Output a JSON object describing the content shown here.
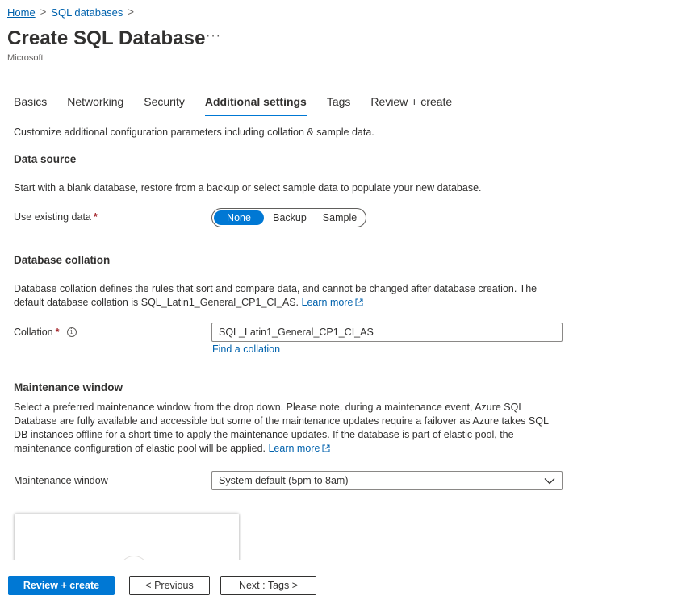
{
  "breadcrumb": {
    "home": "Home",
    "sql_databases": "SQL databases",
    "separator": ">"
  },
  "header": {
    "title": "Create SQL Database",
    "more": "···",
    "publisher": "Microsoft"
  },
  "tabs": [
    {
      "label": "Basics",
      "active": false
    },
    {
      "label": "Networking",
      "active": false
    },
    {
      "label": "Security",
      "active": false
    },
    {
      "label": "Additional settings",
      "active": true
    },
    {
      "label": "Tags",
      "active": false
    },
    {
      "label": "Review + create",
      "active": false
    }
  ],
  "intro": "Customize additional configuration parameters including collation & sample data.",
  "data_source": {
    "title": "Data source",
    "description": "Start with a blank database, restore from a backup or select sample data to populate your new database.",
    "label": "Use existing data",
    "required": "*",
    "options": [
      "None",
      "Backup",
      "Sample"
    ],
    "selected": "None"
  },
  "collation": {
    "title": "Database collation",
    "description_line1": "Database collation defines the rules that sort and compare data, and cannot be changed after database creation. The",
    "description_line2": "default database collation is SQL_Latin1_General_CP1_CI_AS.",
    "learn_more": "Learn more",
    "label": "Collation",
    "required": "*",
    "info": "i",
    "value": "SQL_Latin1_General_CP1_CI_AS",
    "find_link": "Find a collation"
  },
  "maintenance": {
    "title": "Maintenance window",
    "line1": "Select a preferred maintenance window from the drop down. Please note, during a maintenance event, Azure SQL",
    "line2": "Database are fully available and accessible but some of the maintenance updates require a failover as Azure takes SQL",
    "line3": "DB instances offline for a short time to apply the maintenance updates. If the database is part of elastic pool, the",
    "line4": "maintenance configuration of elastic pool will be applied.",
    "learn_more": "Learn more",
    "label": "Maintenance window",
    "value": "System default (5pm to 8am)"
  },
  "footer": {
    "review_create": "Review + create",
    "previous": "< Previous",
    "next": "Next : Tags >"
  },
  "colors": {
    "accent": "#0078d4",
    "link": "#0062ad",
    "required": "#a4262c",
    "text": "#323130"
  }
}
